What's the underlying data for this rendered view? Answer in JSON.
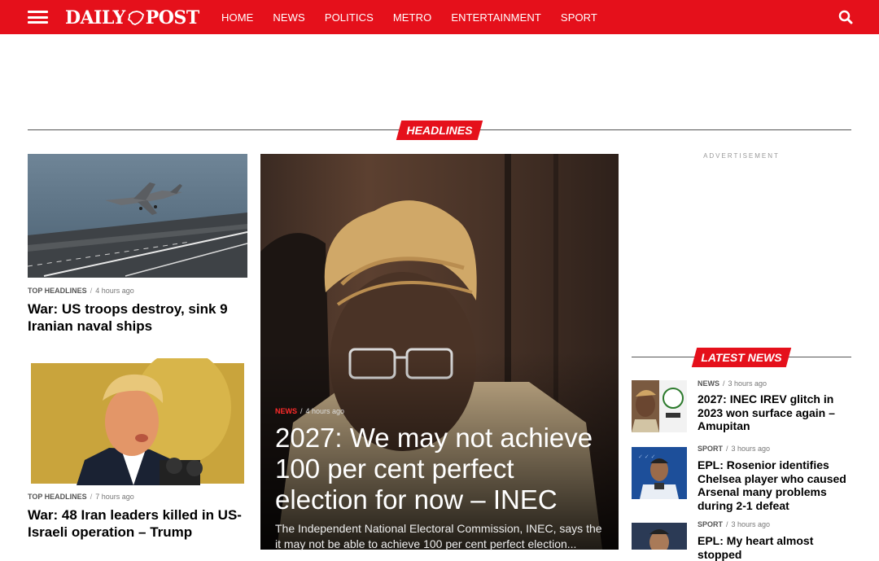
{
  "header": {
    "logo_left": "DAILY",
    "logo_right": "POST",
    "nav": [
      "HOME",
      "NEWS",
      "POLITICS",
      "METRO",
      "ENTERTAINMENT",
      "SPORT"
    ],
    "brand_color": "#e5101b"
  },
  "headlines_label": "HEADLINES",
  "left_articles": [
    {
      "category": "TOP HEADLINES",
      "time": "4 hours ago",
      "title": "War: US troops destroy, sink 9 Iranian naval ships"
    },
    {
      "category": "TOP HEADLINES",
      "time": "7 hours ago",
      "title": "War: 48 Iran leaders killed in US-Israeli operation – Trump"
    }
  ],
  "hero": {
    "category": "NEWS",
    "time": "4 hours ago",
    "title": "2027: We may not achieve 100 per cent perfect election for now – INEC",
    "excerpt": "The Independent National Electoral Commission, INEC, says the it may not be able to achieve 100 per cent perfect election..."
  },
  "advertisement_label": "ADVERTISEMENT",
  "latest_news_label": "LATEST NEWS",
  "latest_news": [
    {
      "category": "NEWS",
      "time": "3 hours ago",
      "title": "2027: INEC IREV glitch in 2023 won surface again – Amupitan"
    },
    {
      "category": "SPORT",
      "time": "3 hours ago",
      "title": "EPL: Rosenior identifies Chelsea player who caused Arsenal many problems during 2-1 defeat"
    },
    {
      "category": "SPORT",
      "time": "3 hours ago",
      "title": "EPL: My heart almost stopped"
    }
  ]
}
